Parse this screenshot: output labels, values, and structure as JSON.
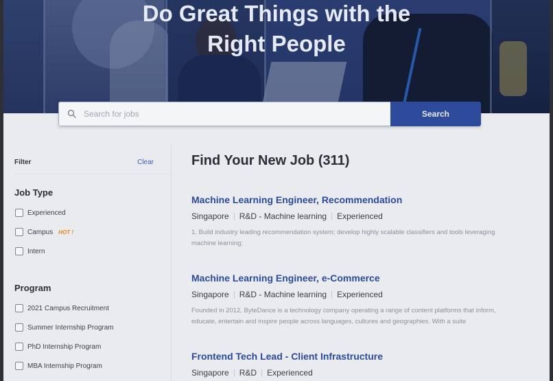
{
  "hero": {
    "title_line1": "Do Great Things with the",
    "title_line2": "Right People"
  },
  "search": {
    "placeholder": "Search for jobs",
    "button_label": "Search"
  },
  "filter": {
    "label": "Filter",
    "clear_label": "Clear",
    "job_type": {
      "title": "Job Type",
      "options": [
        "Experienced",
        "Campus",
        "Intern"
      ],
      "hot_badge": "HOT !"
    },
    "program": {
      "title": "Program",
      "options": [
        "2021 Campus Recruitment",
        "Summer Internship Program",
        "PhD Internship Program",
        "MBA Internship Program"
      ]
    }
  },
  "results": {
    "title": "Find Your New Job (311)",
    "jobs": [
      {
        "title": "Machine Learning Engineer, Recommendation",
        "location": "Singapore",
        "category": "R&D - Machine learning",
        "level": "Experienced",
        "description": "1. Build industry leading recommendation system; develop highly scalable classifiers and tools leveraging machine learning;"
      },
      {
        "title": "Machine Learning Engineer, e-Commerce",
        "location": "Singapore",
        "category": "R&D - Machine learning",
        "level": "Experienced",
        "description": "Founded in 2012, ByteDance is a technology company operating a range of content platforms that inform, educate, entertain and inspire people across languages, cultures and geographies. With a suite"
      },
      {
        "title": "Frontend Tech Lead - Client Infrastructure",
        "location": "Singapore",
        "category": "R&D",
        "level": "Experienced",
        "description": ""
      }
    ]
  },
  "colors": {
    "accent": "#2d4a9b",
    "job_title": "#2b4a9c",
    "hot": "#e8881e"
  }
}
